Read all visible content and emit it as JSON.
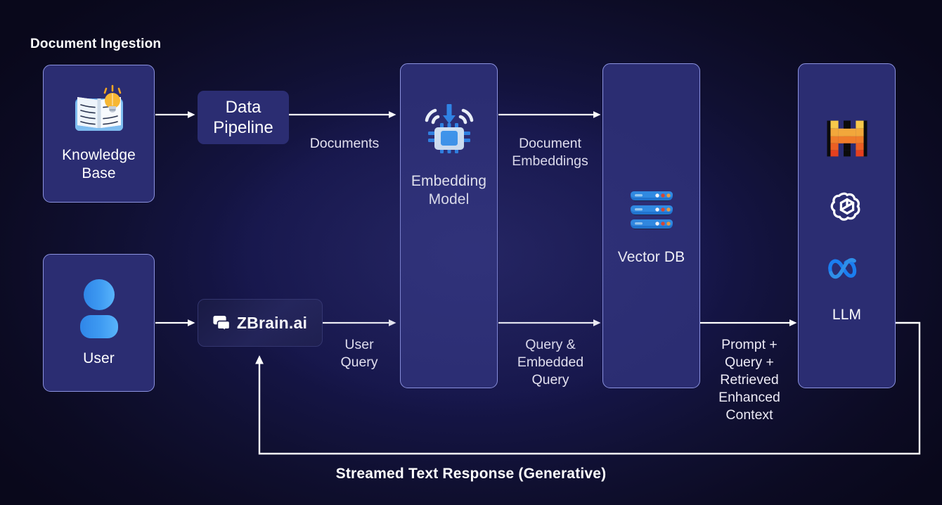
{
  "diagram": {
    "title_label": "Document Ingestion",
    "bottom_label": "Streamed Text Response (Generative)",
    "colors": {
      "background": "#0b0a1e",
      "background_center": "#1b1b52",
      "card_fill": "#2b2d72",
      "card_border": "#8c93e0",
      "wire": "#ffffff",
      "accent_blue": "#2f86e8",
      "icon_light": "#d8eaf8",
      "mistral_yellow": "#f2b73c",
      "mistral_orange": "#ef7c2a",
      "mistral_red": "#e74c23",
      "meta_blue": "#1b7ef0"
    }
  },
  "nodes": {
    "knowledge_base": {
      "label": "Knowledge\nBase",
      "icon": "open-book-lightbulb-icon"
    },
    "data_pipeline": {
      "label": "Data\nPipeline"
    },
    "user": {
      "label": "User",
      "icon": "user-avatar-icon"
    },
    "zbrain": {
      "label": "ZBrain.ai",
      "icon": "chat-bubble-icon"
    },
    "embedding_model": {
      "label": "Embedding\nModel",
      "icon": "cpu-chip-embedding-icon"
    },
    "vector_db": {
      "label": "Vector\nDB",
      "icon": "server-stack-icon"
    },
    "llm": {
      "label": "LLM",
      "logos": [
        {
          "name": "mistral-logo",
          "title": "Mistral AI"
        },
        {
          "name": "openai-logo",
          "title": "OpenAI"
        },
        {
          "name": "meta-logo",
          "title": "Meta"
        }
      ]
    }
  },
  "edges": [
    {
      "id": "kb-to-pipeline",
      "label": ""
    },
    {
      "id": "pipeline-to-embedding",
      "label": "Documents"
    },
    {
      "id": "embedding-to-vectordb",
      "label": "Document\nEmbeddings"
    },
    {
      "id": "user-to-zbrain",
      "label": ""
    },
    {
      "id": "zbrain-to-embedding",
      "label": "User\nQuery"
    },
    {
      "id": "embedding-to-vectordb-query",
      "label": "Query &\nEmbedded\nQuery"
    },
    {
      "id": "vectordb-to-llm",
      "label": "Prompt +\nQuery +\nRetrieved\nEnhanced\nContext"
    },
    {
      "id": "llm-to-zbrain",
      "label": "Streamed Text Response (Generative)"
    }
  ]
}
